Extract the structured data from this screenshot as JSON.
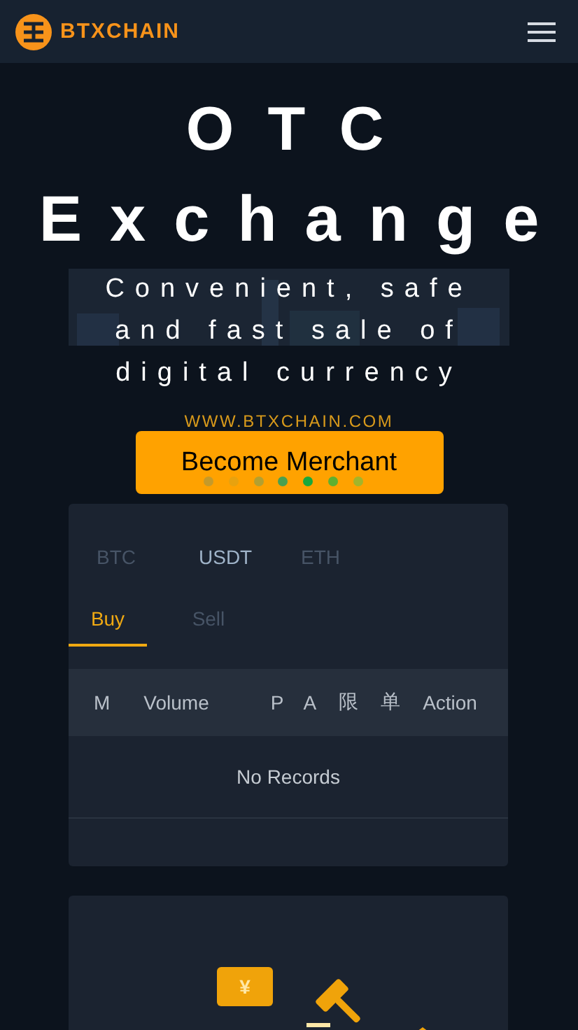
{
  "header": {
    "logo_text": "BTXCHAIN"
  },
  "hero": {
    "title": "O T C",
    "subtitle": "Exchange",
    "tagline": "Convenient, safe and fast sale of digital currency",
    "url": "WWW.BTXCHAIN.COM",
    "button": "Become Merchant"
  },
  "market": {
    "coins": [
      {
        "label": "BTC",
        "selected": false
      },
      {
        "label": "USDT",
        "selected": true
      },
      {
        "label": "ETH",
        "selected": false
      }
    ],
    "sides": [
      {
        "label": "Buy",
        "selected": true
      },
      {
        "label": "Sell",
        "selected": false
      }
    ],
    "columns": [
      "M",
      "Volume",
      "P",
      "A",
      "限",
      "单",
      "Action"
    ],
    "empty": "No Records"
  },
  "features": {
    "ticket_symbol": "¥"
  }
}
